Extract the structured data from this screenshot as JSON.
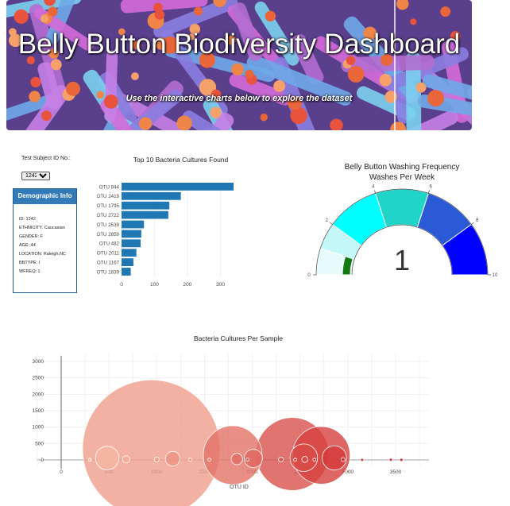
{
  "header": {
    "title": "Belly Button Biodiversity Dashboard",
    "subtitle": "Use the interactive charts below to explore the dataset"
  },
  "controls": {
    "select_label": "Test Subject ID No.:",
    "selected_id": "1242"
  },
  "demographics": {
    "heading": "Demographic Info",
    "rows": [
      "ID: 1242",
      "ETHNICITY: Caucasian",
      "GENDER: F",
      "AGE: 44",
      "LOCATION: Raleigh,NC",
      "BBTYPE: I",
      "WFREQ: 1"
    ]
  },
  "colors": {
    "bar": "#1f77b4",
    "banner_accent": "#5a3f8c",
    "gauge_bands": [
      "#e8fbfb",
      "#c4f7f7",
      "#00ffff",
      "#20d5c8",
      "#2b5ad6",
      "#0000ff"
    ],
    "gauge_needle": "#137a13"
  },
  "chart_data": [
    {
      "type": "bar",
      "orientation": "horizontal",
      "title": "Top 10 Bacteria Cultures Found",
      "categories": [
        "OTU 944",
        "OTU 2419",
        "OTU 1795",
        "OTU 2722",
        "OTU 2539",
        "OTU 2859",
        "OTU 482",
        "OTU 2011",
        "OTU 1167",
        "OTU 1839"
      ],
      "values": [
        340,
        180,
        145,
        142,
        68,
        60,
        58,
        45,
        36,
        28
      ],
      "xlim": [
        0,
        340
      ],
      "xticks": [
        0,
        100,
        200,
        300
      ]
    },
    {
      "type": "gauge",
      "title": "Belly Button Washing Frequency",
      "subtitle": "Washes Per Week",
      "value": 1,
      "range": [
        0,
        10
      ],
      "ticks": [
        0,
        2,
        4,
        6,
        8,
        10
      ]
    },
    {
      "type": "scatter",
      "subtype": "bubble",
      "title": "Bacteria Cultures Per Sample",
      "xlabel": "OTU ID",
      "xlim": [
        -250,
        3850
      ],
      "ylim": [
        -300,
        3050
      ],
      "xticks": [
        0,
        500,
        1000,
        1500,
        2000,
        2500,
        3000,
        3500
      ],
      "yticks": [
        0,
        500,
        1000,
        1500,
        2000,
        2500,
        3000
      ],
      "grid": true,
      "points": [
        {
          "x": 944,
          "y": 340,
          "size": 340
        },
        {
          "x": 1795,
          "y": 145,
          "size": 145
        },
        {
          "x": 2419,
          "y": 180,
          "size": 180
        },
        {
          "x": 2722,
          "y": 142,
          "size": 142
        },
        {
          "x": 2539,
          "y": 68,
          "size": 68
        },
        {
          "x": 2859,
          "y": 60,
          "size": 60
        },
        {
          "x": 482,
          "y": 58,
          "size": 58
        },
        {
          "x": 2011,
          "y": 45,
          "size": 45
        },
        {
          "x": 1167,
          "y": 36,
          "size": 36
        },
        {
          "x": 1839,
          "y": 28,
          "size": 28
        },
        {
          "x": 680,
          "y": 18,
          "size": 18
        },
        {
          "x": 2550,
          "y": 15,
          "size": 15
        },
        {
          "x": 2300,
          "y": 12,
          "size": 12
        },
        {
          "x": 2950,
          "y": 10,
          "size": 10
        },
        {
          "x": 1000,
          "y": 12,
          "size": 12
        },
        {
          "x": 3450,
          "y": 6,
          "size": 6
        },
        {
          "x": 1350,
          "y": 5,
          "size": 5
        },
        {
          "x": 1950,
          "y": 8,
          "size": 8
        },
        {
          "x": 2450,
          "y": 5,
          "size": 5
        },
        {
          "x": 2650,
          "y": 5,
          "size": 5
        },
        {
          "x": 1550,
          "y": 4,
          "size": 4
        },
        {
          "x": 3150,
          "y": 4,
          "size": 4
        },
        {
          "x": 300,
          "y": 3,
          "size": 3
        },
        {
          "x": 3560,
          "y": 3,
          "size": 3
        }
      ],
      "colorscale_from": "#fdd0b5",
      "colorscale_to": "#cb181d"
    }
  ]
}
